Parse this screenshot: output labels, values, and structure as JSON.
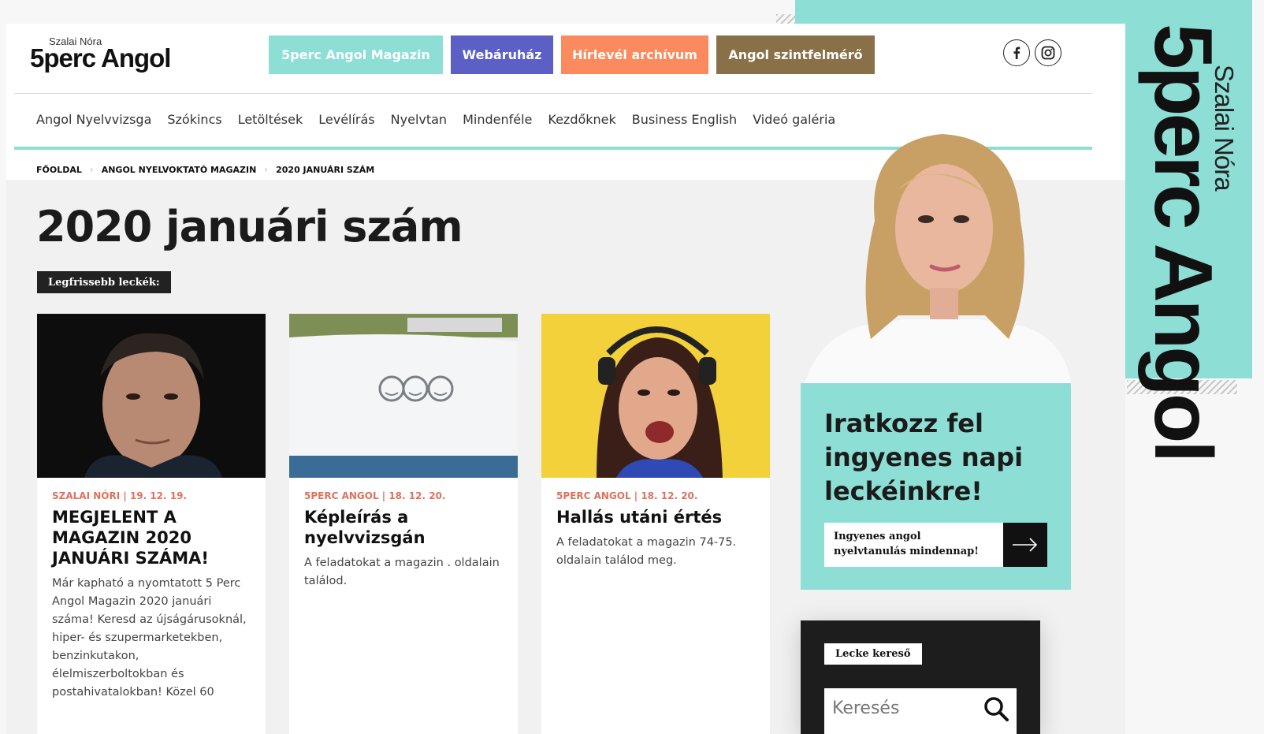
{
  "brand": {
    "small": "Szalai Nóra",
    "main": "5perc Angol",
    "vertical_small": "Szalai Nóra",
    "vertical_main": "5perc Angol"
  },
  "top_nav": [
    {
      "label": "5perc Angol Magazin",
      "color": "#8ddfd6"
    },
    {
      "label": "Webáruház",
      "color": "#5c5fc6"
    },
    {
      "label": "Hírlevél archívum",
      "color": "#fb8a5f"
    },
    {
      "label": "Angol szintfelmérő",
      "color": "#8a7048"
    }
  ],
  "social": {
    "facebook": "facebook-icon",
    "instagram": "instagram-icon"
  },
  "main_nav": [
    "Angol Nyelvvizsga",
    "Szókincs",
    "Letöltések",
    "Levélírás",
    "Nyelvtan",
    "Mindenféle",
    "Kezdőknek",
    "Business English",
    "Videó galéria"
  ],
  "breadcrumb": [
    "FŐOLDAL",
    "ANGOL NYELVOKTATÓ MAGAZIN",
    "2020 JANUÁRI SZÁM"
  ],
  "page_title": "2020 januári szám",
  "latest_badge": "Legfrissebb leckék:",
  "cards": [
    {
      "meta": "SZALAI NÓRI | 19. 12. 19.",
      "title": "MEGJELENT A MAGAZIN 2020 JANUÁRI SZÁMA!",
      "excerpt": "Már kapható a nyomtatott 5 Perc Angol Magazin 2020 januári száma! Keresd az újságárusoknál, hiper- és szupermarketekben, benzinkutakon, élelmiszerboltokban és postahivatalokban! Közel 60"
    },
    {
      "meta": "5PERC ANGOL | 18. 12. 20.",
      "title": "Képleírás a nyelvvizsgán",
      "excerpt": "A feladatokat a magazin . oldalain találod."
    },
    {
      "meta": "5PERC ANGOL | 18. 12. 20.",
      "title": "Hallás utáni értés",
      "excerpt": "A feladatokat a magazin 74-75. oldalain találod meg."
    }
  ],
  "signup": {
    "title": "Iratkozz fel ingyenes napi leckéinkre!",
    "button": "Ingyenes angol nyelvtanulás mindennap!"
  },
  "search": {
    "label": "Lecke kereső",
    "placeholder": "Keresés"
  },
  "colors": {
    "accent": "#8ddfd6",
    "meta": "#e0715c"
  }
}
